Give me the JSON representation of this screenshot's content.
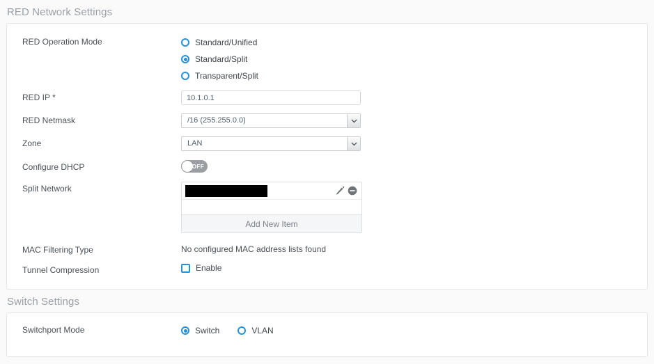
{
  "red_section": {
    "header": "RED Network Settings",
    "operation_mode": {
      "label": "RED Operation Mode",
      "options": [
        {
          "label": "Standard/Unified",
          "selected": false
        },
        {
          "label": "Standard/Split",
          "selected": true
        },
        {
          "label": "Transparent/Split",
          "selected": false
        }
      ]
    },
    "red_ip": {
      "label": "RED IP *",
      "value": "10.1.0.1",
      "placeholder": ""
    },
    "red_netmask": {
      "label": "RED Netmask",
      "value": "/16 (255.255.0.0)"
    },
    "zone": {
      "label": "Zone",
      "value": "LAN"
    },
    "configure_dhcp": {
      "label": "Configure DHCP",
      "state": "OFF"
    },
    "split_network": {
      "label": "Split Network",
      "item_value": "",
      "edit_icon": "pencil-icon",
      "remove_icon": "remove-circle-icon",
      "add_label": "Add New Item"
    },
    "mac_filtering": {
      "label": "MAC Filtering Type",
      "value": "No configured MAC address lists found"
    },
    "tunnel_compression": {
      "label": "Tunnel Compression",
      "checkbox_label": "Enable",
      "checked": false
    }
  },
  "switch_section": {
    "header": "Switch Settings",
    "switchport_mode": {
      "label": "Switchport Mode",
      "options": [
        {
          "label": "Switch",
          "selected": true
        },
        {
          "label": "VLAN",
          "selected": false
        }
      ]
    }
  },
  "colors": {
    "accent": "#2a8fd4",
    "header_text": "#9aa0a6",
    "label_text": "#4b5157",
    "page_bg": "#fafafa",
    "panel_bg": "#ffffff",
    "toggle_off": "#9b9fa3"
  }
}
